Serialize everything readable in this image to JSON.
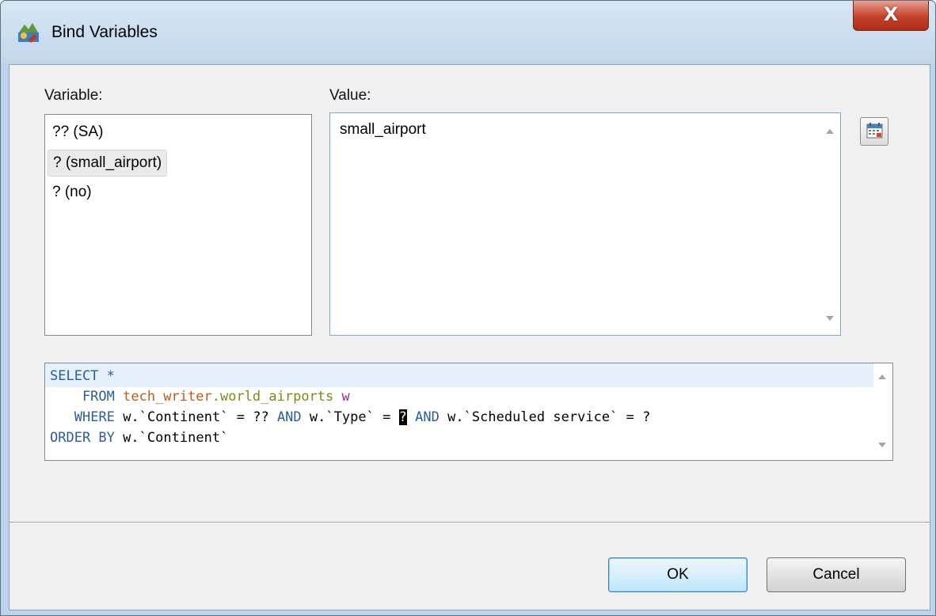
{
  "window": {
    "title": "Bind Variables",
    "close_symbol": "X"
  },
  "variables": {
    "label": "Variable:",
    "items": [
      {
        "text": "?? (SA)"
      },
      {
        "text": "? (small_airport)",
        "selected": true
      },
      {
        "text": "? (no)"
      }
    ]
  },
  "value": {
    "label": "Value:",
    "text": "small_airport"
  },
  "icons": {
    "app": "app-icon",
    "calendar": "calendar-icon"
  },
  "sql": {
    "lines": [
      [
        "SELECT *"
      ],
      [
        "    FROM ",
        "tech_writer",
        ".",
        "world_airports",
        " w"
      ],
      [
        "   WHERE w.`Continent` = ?? AND w.`Type` = ",
        "?",
        " AND w.`Scheduled service` = ?"
      ],
      [
        "ORDER BY w.`Continent`"
      ]
    ],
    "keywords": [
      "SELECT",
      "FROM",
      "WHERE",
      "AND",
      "ORDER BY"
    ]
  },
  "buttons": {
    "ok": "OK",
    "cancel": "Cancel"
  }
}
